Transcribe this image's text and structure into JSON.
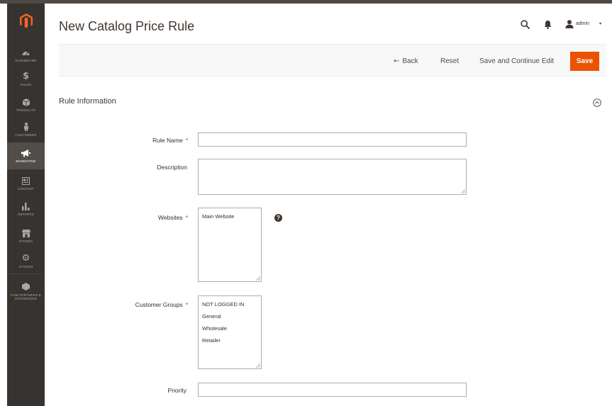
{
  "header": {
    "page_title": "New Catalog Price Rule",
    "user_name": "admin",
    "user_caret": "▾"
  },
  "sidebar": {
    "items": [
      {
        "label": "DASHBOARD",
        "icon": "gauge-icon"
      },
      {
        "label": "SALES",
        "icon": "dollar-icon"
      },
      {
        "label": "PRODUCTS",
        "icon": "cube-icon"
      },
      {
        "label": "CUSTOMERS",
        "icon": "person-icon"
      },
      {
        "label": "MARKETING",
        "icon": "megaphone-icon"
      },
      {
        "label": "CONTENT",
        "icon": "content-icon"
      },
      {
        "label": "REPORTS",
        "icon": "bar-chart-icon"
      },
      {
        "label": "STORES",
        "icon": "store-icon"
      },
      {
        "label": "SYSTEM",
        "icon": "gear-icon"
      },
      {
        "label": "FIND PARTNERS & EXTENSIONS",
        "icon": "box-icon"
      }
    ],
    "active": "MARKETING"
  },
  "actionbar": {
    "back_arrow": "←",
    "back_label": "Back",
    "reset_label": "Reset",
    "save_continue_label": "Save and Continue Edit",
    "save_label": "Save"
  },
  "section": {
    "title": "Rule Information"
  },
  "form": {
    "required_marker": "*",
    "rule_name_label": "Rule Name",
    "rule_name_value": "",
    "description_label": "Description",
    "description_value": "",
    "websites_label": "Websites",
    "websites_options": [
      "Main Website"
    ],
    "websites_help": "?",
    "customer_groups_label": "Customer Groups",
    "customer_groups_options": [
      "NOT LOGGED IN",
      "General",
      "Wholesale",
      "Retailer"
    ],
    "priority_label": "Priority",
    "priority_value": ""
  },
  "colors": {
    "brand_orange": "#eb5202",
    "sidebar_bg": "#373330",
    "required": "#e22626"
  }
}
